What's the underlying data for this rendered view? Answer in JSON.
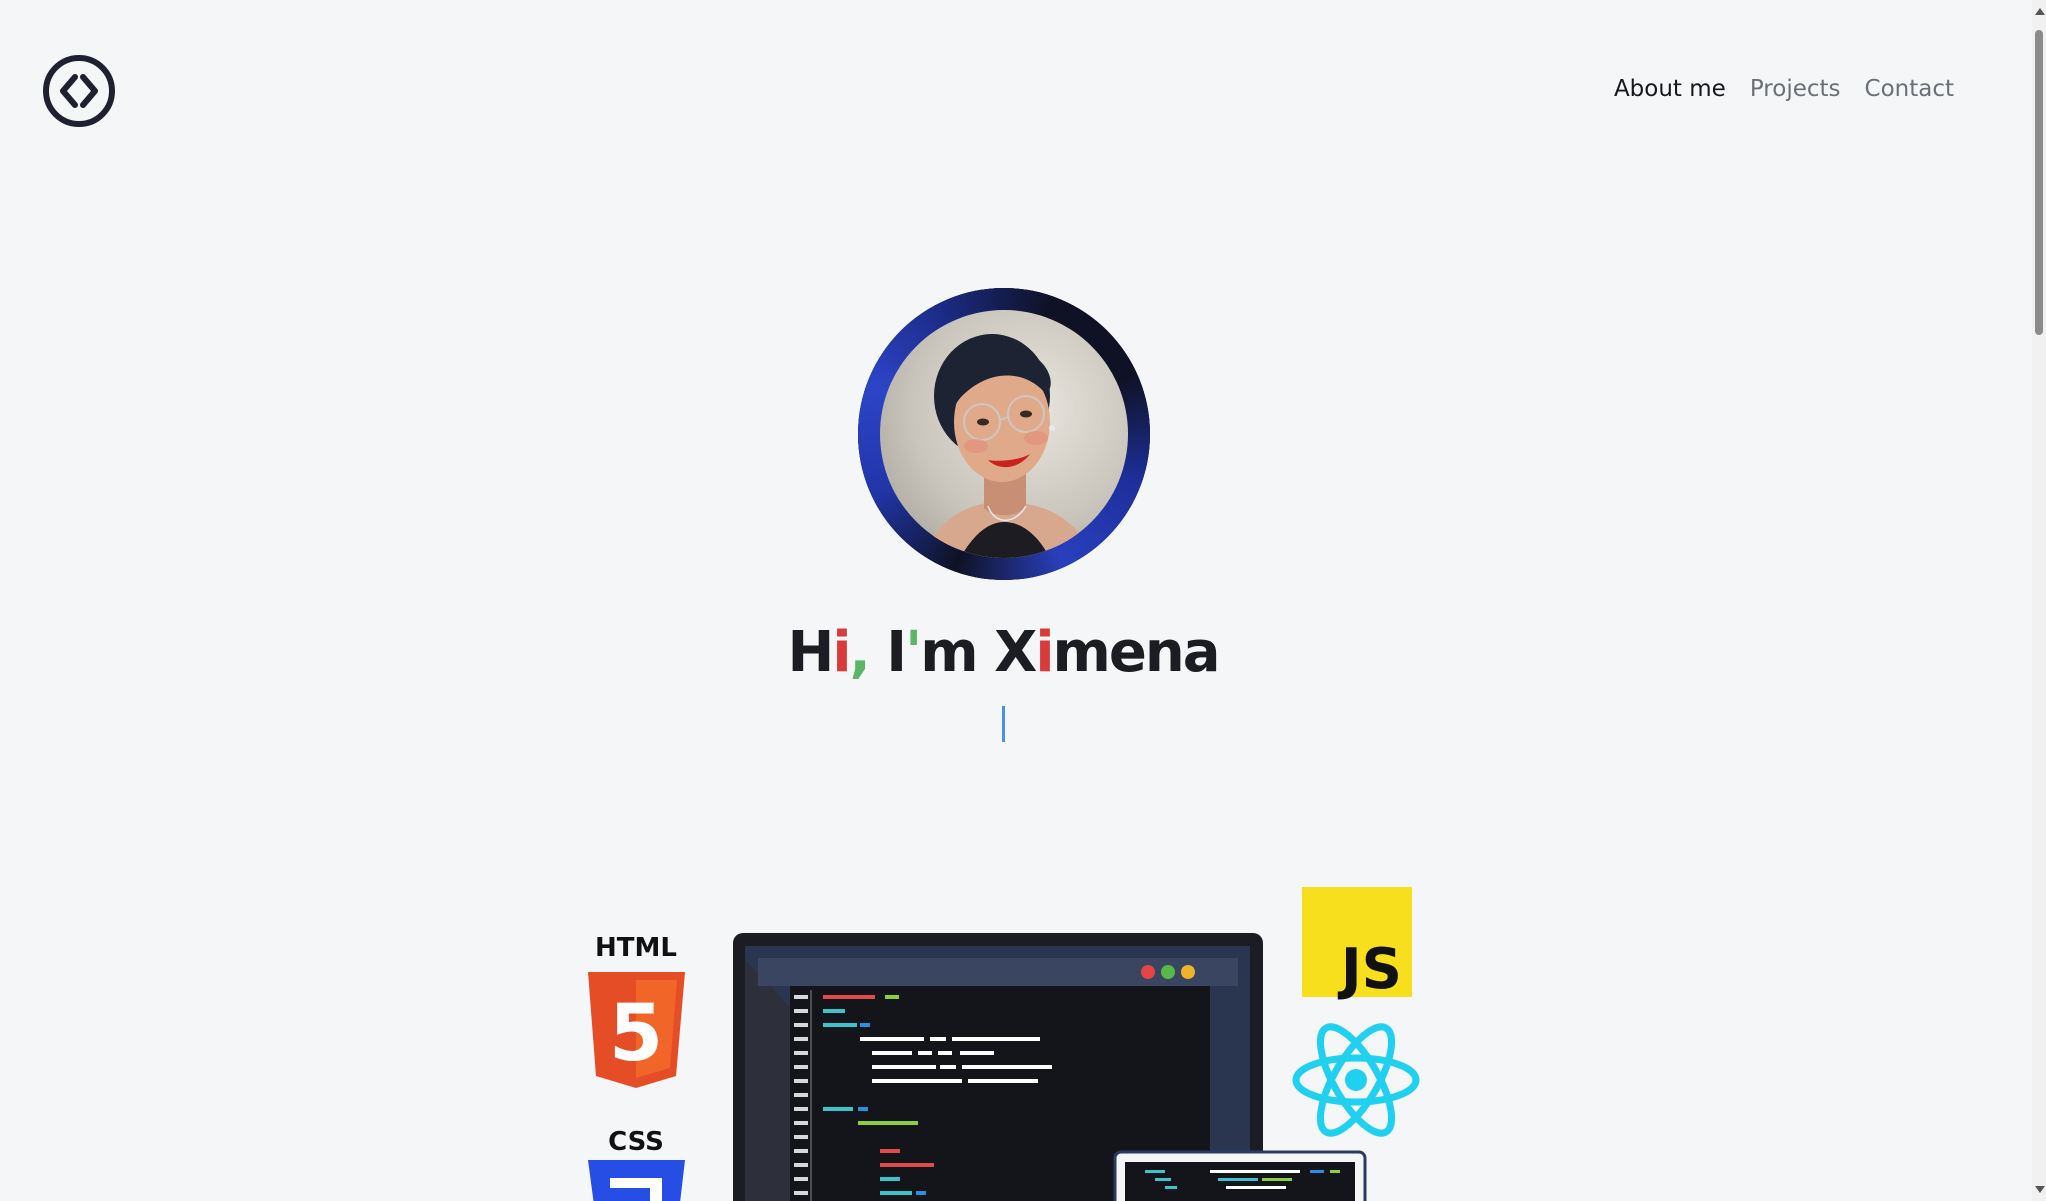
{
  "nav": {
    "items": [
      {
        "label": "About me",
        "active": true
      },
      {
        "label": "Projects",
        "active": false
      },
      {
        "label": "Contact",
        "active": false
      }
    ]
  },
  "logo": {
    "icon": "code-brackets-icon"
  },
  "hero": {
    "greeting_prefix": "H",
    "greeting_i": "i",
    "greeting_comma": ",",
    "greeting_space": " I",
    "greeting_apostrophe": "'",
    "greeting_m": "m ",
    "name_x": "X",
    "name_i": "i",
    "name_rest": "mena"
  },
  "badges": {
    "html": "HTML",
    "html_version": "5",
    "css": "CSS",
    "js": "JS"
  },
  "colors": {
    "background": "#f5f6f8",
    "nav_active": "#16181d",
    "nav_inactive": "#6b6f78",
    "accent_red": "#d93b3b",
    "accent_green": "#5db56a",
    "caret": "#4a8fe8",
    "js_yellow": "#f7df1e",
    "react_cyan": "#1fd0ef",
    "html_orange": "#e44d26",
    "css_blue": "#264de4"
  }
}
